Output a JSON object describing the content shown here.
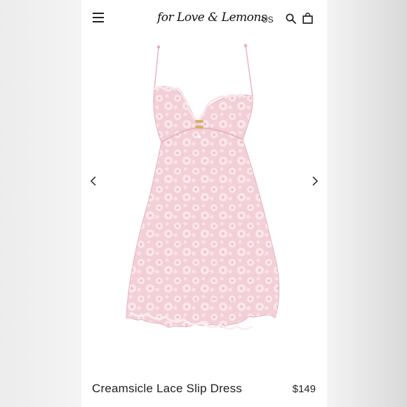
{
  "header": {
    "logo_text": "for Love & Lemons",
    "region": "US",
    "icons": {
      "menu": "hamburger-menu-icon",
      "search": "search-icon",
      "bag": "shopping-bag-icon"
    }
  },
  "gallery": {
    "product_image": "pink lace slip dress",
    "prev_icon": "chevron-left-icon",
    "next_icon": "chevron-right-icon"
  },
  "product": {
    "title": "Creamsicle Lace Slip Dress",
    "price": "$149"
  },
  "colors": {
    "dress_pink": "#f3cfd6",
    "lace_light": "#fbeef1",
    "text": "#222222",
    "background": "#ffffff"
  }
}
